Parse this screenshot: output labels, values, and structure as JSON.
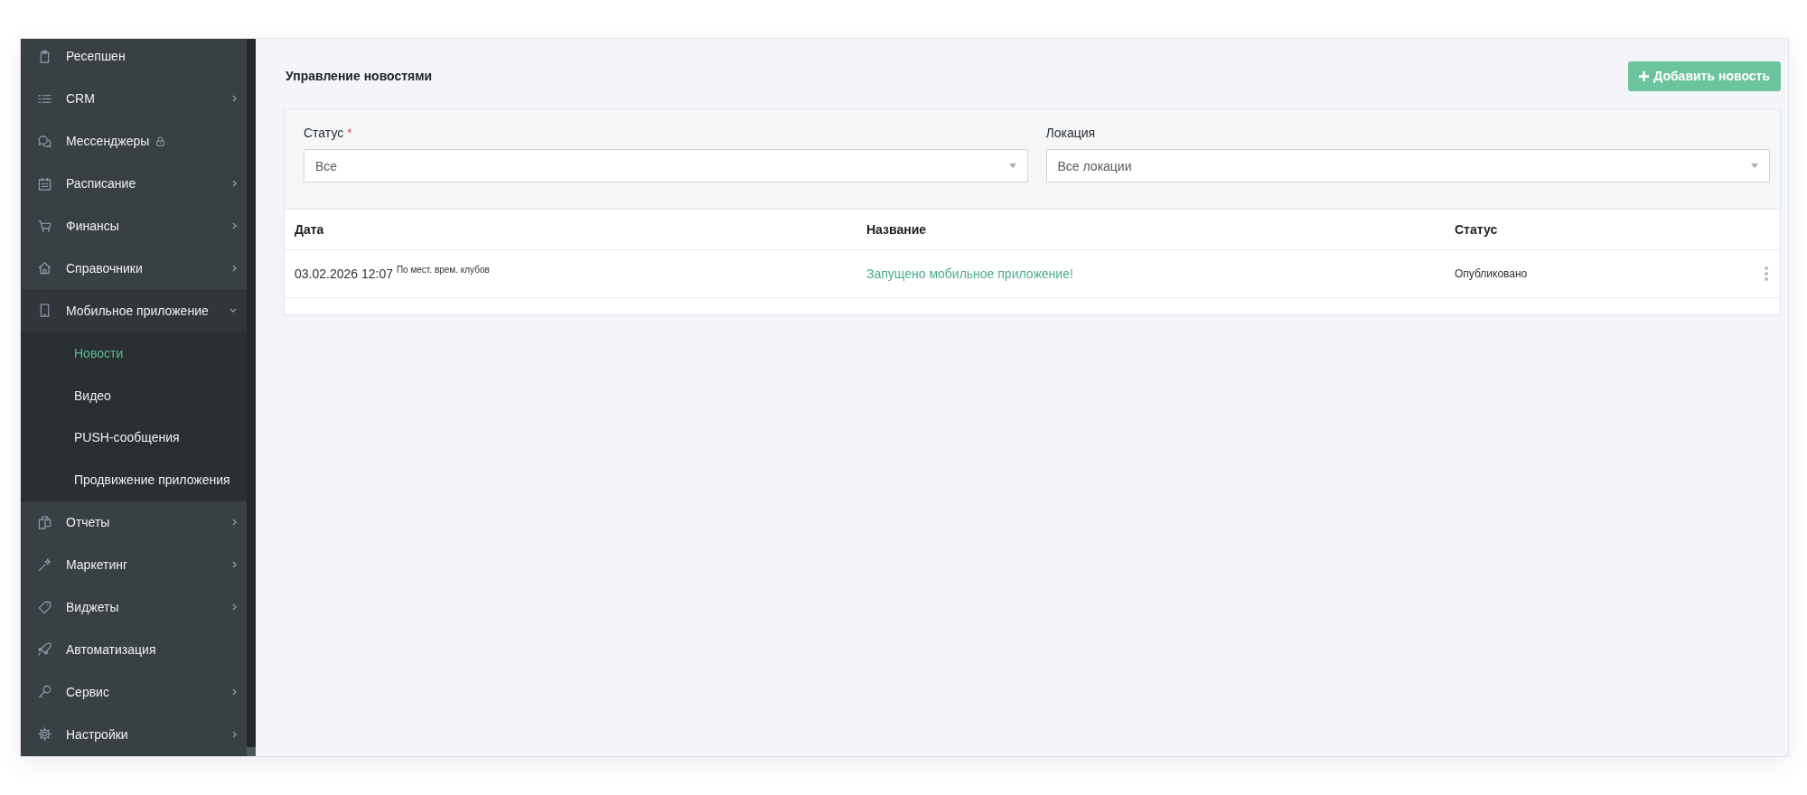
{
  "sidebar": {
    "items": [
      {
        "label": "Ресепшен",
        "kind": "link"
      },
      {
        "label": "CRM",
        "kind": "group",
        "expanded": false
      },
      {
        "label": "Мессенджеры",
        "kind": "link",
        "locked": true
      },
      {
        "label": "Расписание",
        "kind": "group",
        "expanded": false
      },
      {
        "label": "Финансы",
        "kind": "group",
        "expanded": false
      },
      {
        "label": "Справочники",
        "kind": "group",
        "expanded": false
      },
      {
        "label": "Мобильное приложение",
        "kind": "group",
        "expanded": true,
        "children": [
          {
            "label": "Новости",
            "selected": true
          },
          {
            "label": "Видео",
            "selected": false
          },
          {
            "label": "PUSH-сообщения",
            "selected": false
          },
          {
            "label": "Продвижение приложения",
            "selected": false
          }
        ]
      },
      {
        "label": "Отчеты",
        "kind": "group",
        "expanded": false
      },
      {
        "label": "Маркетинг",
        "kind": "group",
        "expanded": false
      },
      {
        "label": "Виджеты",
        "kind": "group",
        "expanded": false
      },
      {
        "label": "Автоматизация",
        "kind": "link"
      },
      {
        "label": "Сервис",
        "kind": "group",
        "expanded": false
      },
      {
        "label": "Настройки",
        "kind": "group",
        "expanded": false
      }
    ]
  },
  "page": {
    "title": "Управление новостями",
    "add_button": {
      "label": "Добавить новость"
    }
  },
  "filters": [
    {
      "label": "Статус",
      "required_mark": "*",
      "value": "Все"
    },
    {
      "label": "Локация",
      "value": "Все локации"
    }
  ],
  "table": {
    "columns": [
      "Дата",
      "Название",
      "Статус"
    ],
    "rows": [
      {
        "date": "03.02.2026 12:07 $^{По мест. врем. клубов}$",
        "title": "Запущено мобильное приложение!",
        "status": "Опубликовано"
      }
    ]
  }
}
